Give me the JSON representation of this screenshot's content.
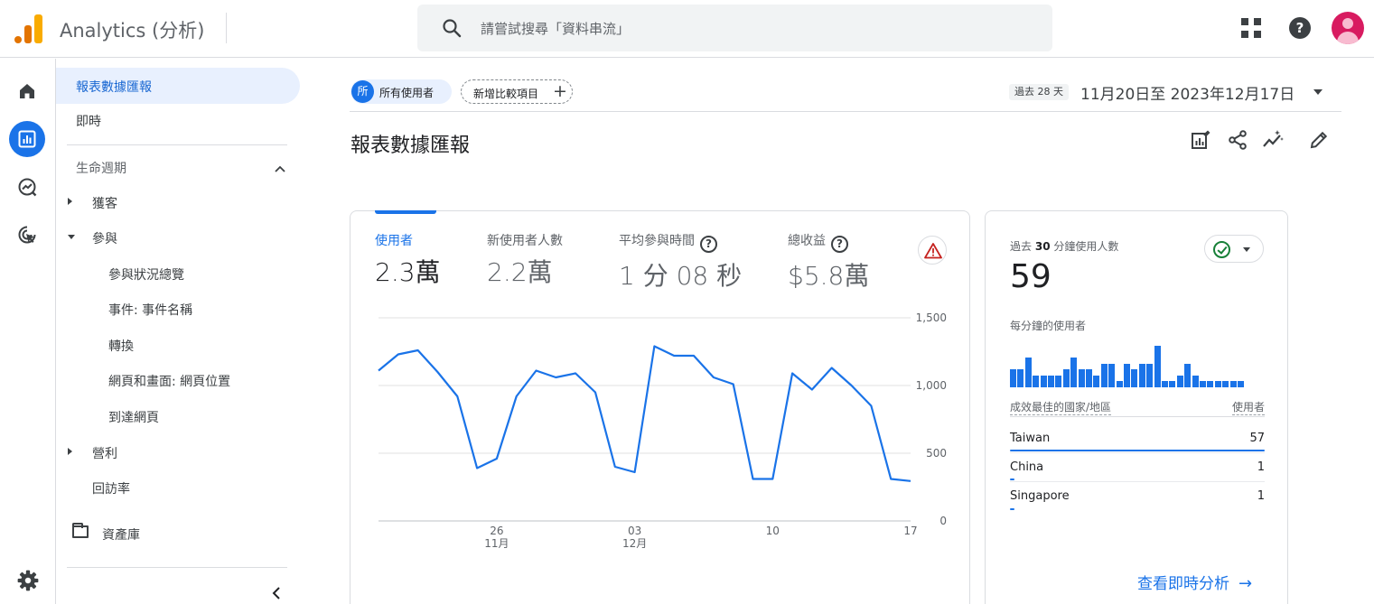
{
  "app": {
    "title": "Analytics (分析)"
  },
  "search": {
    "placeholder": "請嘗試搜尋「資料串流」"
  },
  "sidebar": {
    "items": [
      {
        "label": "報表數據匯報"
      },
      {
        "label": "即時"
      },
      {
        "label": "生命週期"
      },
      {
        "label": "獲客"
      },
      {
        "label": "參與"
      },
      {
        "label": "參與狀況總覽"
      },
      {
        "label": "事件: 事件名稱"
      },
      {
        "label": "轉換"
      },
      {
        "label": "網頁和畫面: 網頁位置"
      },
      {
        "label": "到達網頁"
      },
      {
        "label": "營利"
      },
      {
        "label": "回訪率"
      },
      {
        "label": "資產庫"
      }
    ]
  },
  "filters": {
    "all_users_avatar": "所",
    "all_users": "所有使用者",
    "add_comparison": "新增比較項目",
    "add_icon": "+"
  },
  "date": {
    "badge": "過去 28 天",
    "range": "11月20日至 2023年12月17日"
  },
  "page": {
    "title": "報表數據匯報"
  },
  "metrics": [
    {
      "label": "使用者",
      "value": "2.3萬"
    },
    {
      "label": "新使用者人數",
      "value": "2.2萬"
    },
    {
      "label": "平均參與時間",
      "value": "1 分 08 秒"
    },
    {
      "label": "總收益",
      "value": "$5.8萬"
    }
  ],
  "chart_data": {
    "type": "line",
    "x": [
      "11/20",
      "11/21",
      "11/22",
      "11/23",
      "11/24",
      "11/25",
      "11/26",
      "11/27",
      "11/28",
      "11/29",
      "11/30",
      "12/01",
      "12/02",
      "12/03",
      "12/04",
      "12/05",
      "12/06",
      "12/07",
      "12/08",
      "12/09",
      "12/10",
      "12/11",
      "12/12",
      "12/13",
      "12/14",
      "12/15",
      "12/16",
      "12/17"
    ],
    "series": [
      {
        "values": [
          1110,
          1230,
          1260,
          1100,
          920,
          390,
          460,
          920,
          1110,
          1060,
          1090,
          950,
          400,
          360,
          1290,
          1220,
          1220,
          1060,
          1010,
          310,
          310,
          1090,
          970,
          1130,
          1000,
          850,
          310,
          295
        ]
      }
    ],
    "x_ticks": [
      {
        "day": "26",
        "month": "11月",
        "index": 6
      },
      {
        "day": "03",
        "month": "12月",
        "index": 13
      },
      {
        "day": "10",
        "month": "",
        "index": 20
      },
      {
        "day": "17",
        "month": "",
        "index": 27
      }
    ],
    "y_ticks": [
      "1,500",
      "1,000",
      "500",
      "0"
    ],
    "ylim": [
      0,
      1500
    ],
    "grid": true,
    "color": "#1a73e8"
  },
  "realtime": {
    "title_prefix": "過去",
    "title_num": "30",
    "title_suffix": "分鐘使用人數",
    "value": "59",
    "per_minute_label": "每分鐘的使用者",
    "bars": [
      3,
      3,
      5,
      2,
      2,
      2,
      2,
      3,
      5,
      3,
      3,
      2,
      4,
      4,
      1,
      4,
      3,
      4,
      4,
      7,
      1,
      1,
      2,
      4,
      2,
      1,
      1,
      1,
      1,
      1,
      1
    ],
    "bar_max": 7,
    "col_country": "成效最佳的國家/地區",
    "col_users": "使用者",
    "rows": [
      {
        "country": "Taiwan",
        "users": "57",
        "fraction": 1.0
      },
      {
        "country": "China",
        "users": "1",
        "fraction": 0.018
      },
      {
        "country": "Singapore",
        "users": "1",
        "fraction": 0.018
      }
    ],
    "link": "查看即時分析",
    "link_arrow": "→"
  }
}
